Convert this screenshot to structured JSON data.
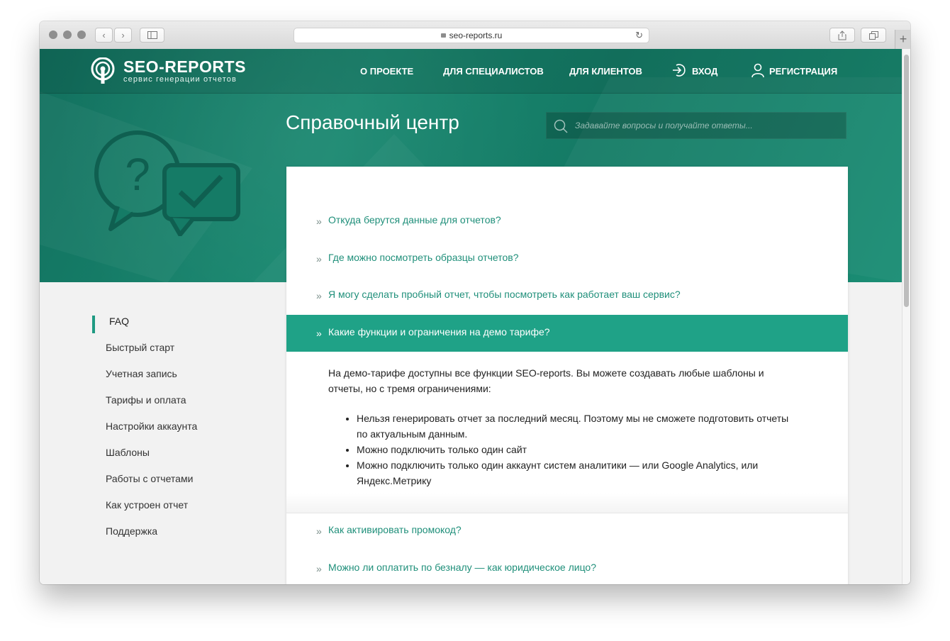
{
  "browser": {
    "url": "seo-reports.ru",
    "new_tab": "+"
  },
  "brand": {
    "name": "SEO-REPORTS",
    "tagline": "сервис генерации отчетов",
    "accent": "#1fa287"
  },
  "nav": {
    "about": "О ПРОЕКТЕ",
    "specialists": "ДЛЯ СПЕЦИАЛИСТОВ",
    "clients": "ДЛЯ КЛИЕНТОВ",
    "login": "ВХОД",
    "register": "РЕГИСТРАЦИЯ"
  },
  "header": {
    "title": "Справочный центр",
    "search_placeholder": "Задавайте вопросы и получайте ответы..."
  },
  "sidebar": {
    "items": [
      {
        "label": "FAQ",
        "active": true
      },
      {
        "label": "Быстрый старт"
      },
      {
        "label": "Учетная запись"
      },
      {
        "label": "Тарифы и оплата"
      },
      {
        "label": "Настройки аккаунта"
      },
      {
        "label": "Шаблоны"
      },
      {
        "label": "Работы с отчетами"
      },
      {
        "label": "Как устроен отчет"
      },
      {
        "label": "Поддержка"
      }
    ]
  },
  "faq": {
    "chevron": "»",
    "questions": [
      "Откуда берутся данные для отчетов?",
      "Где можно посмотреть образцы отчетов?",
      "Я могу сделать пробный отчет, чтобы посмотреть как работает ваш сервис?",
      "Какие функции и ограничения на демо тарифе?",
      "Как активировать промокод?",
      "Можно ли оплатить по безналу — как юридическое лицо?"
    ],
    "answer": {
      "intro": "На демо-тарифе доступны все функции SEO-reports. Вы можете создавать любые шаблоны и отчеты, но с тремя ограничениями:",
      "bullets": [
        "Нельзя генерировать отчет за последний месяц. Поэтому мы не сможете подготовить отчеты по актуальным данным.",
        "Можно подключить только один сайт",
        "Можно подключить только один аккаунт систем аналитики — или Google Analytics, или Яндекс.Метрику"
      ]
    }
  }
}
